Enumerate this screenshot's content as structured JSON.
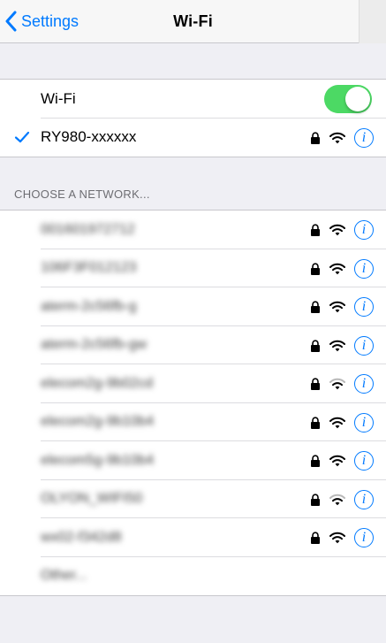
{
  "nav": {
    "back_label": "Settings",
    "title": "Wi-Fi"
  },
  "wifi_toggle": {
    "label": "Wi-Fi",
    "on": true
  },
  "connected": {
    "ssid": "RY980-xxxxxx",
    "secured": true
  },
  "section_header": "CHOOSE A NETWORK...",
  "networks": [
    {
      "ssid": "001601972712",
      "secured": true,
      "signal": "full"
    },
    {
      "ssid": "106F3F012123",
      "secured": true,
      "signal": "full"
    },
    {
      "ssid": "aterm-2c56fb-g",
      "secured": true,
      "signal": "full"
    },
    {
      "ssid": "aterm-2c56fb-gw",
      "secured": true,
      "signal": "full"
    },
    {
      "ssid": "elecom2g-9b02cd",
      "secured": true,
      "signal": "weak"
    },
    {
      "ssid": "elecom2g-9b10b4",
      "secured": true,
      "signal": "full"
    },
    {
      "ssid": "elecom5g-9b10b4",
      "secured": true,
      "signal": "full"
    },
    {
      "ssid": "OLYON_WIFI50",
      "secured": true,
      "signal": "weak"
    },
    {
      "ssid": "wx02-f342d8",
      "secured": true,
      "signal": "full"
    }
  ],
  "other_label": "Other...",
  "colors": {
    "accent": "#007aff",
    "toggle_on": "#4cd964",
    "background": "#efeff4",
    "section_text": "#6d6d72"
  },
  "icons": {
    "back": "chevron-left-icon",
    "check": "checkmark-icon",
    "lock": "lock-icon",
    "wifi": "wifi-signal-icon",
    "info": "info-icon"
  }
}
